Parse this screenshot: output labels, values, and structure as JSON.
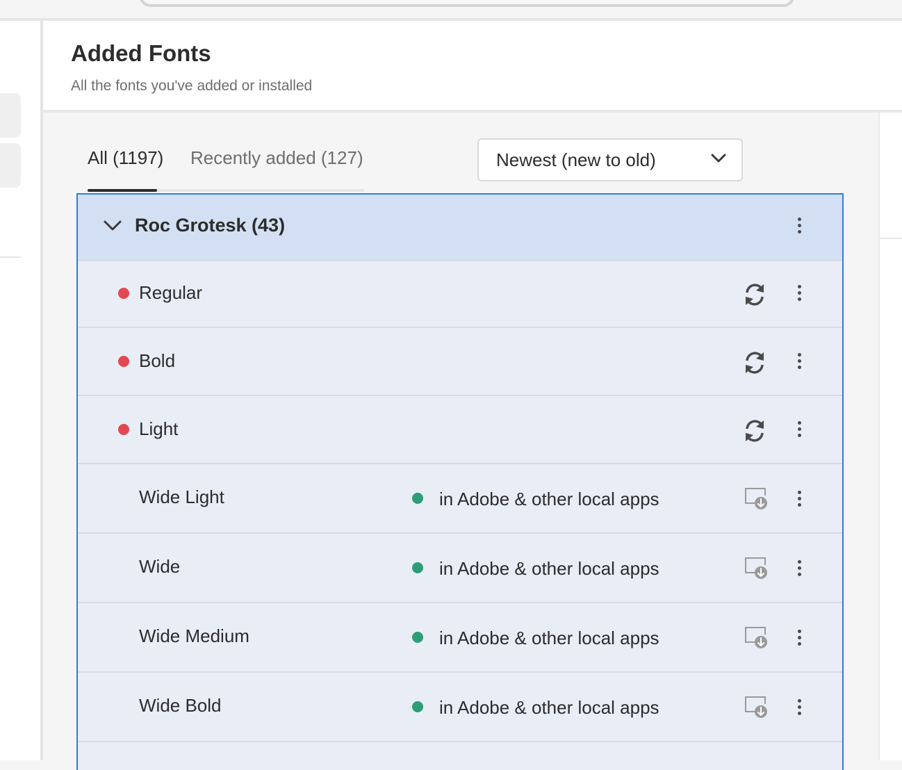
{
  "header": {
    "title": "Added Fonts",
    "subtitle": "All the fonts you've added or installed"
  },
  "tabs": [
    {
      "label": "All (1197)",
      "active": true
    },
    {
      "label": "Recently added (127)",
      "active": false
    }
  ],
  "sort": {
    "selected": "Newest (new to old)",
    "icon": "chevron-down-icon"
  },
  "family": {
    "name": "Roc Grotesk (43)",
    "expanded": true
  },
  "styles": [
    {
      "name": "Regular",
      "status_color": "red",
      "status_text": "",
      "action_icon": "sync-icon"
    },
    {
      "name": "Bold",
      "status_color": "red",
      "status_text": "",
      "action_icon": "sync-icon"
    },
    {
      "name": "Light",
      "status_color": "red",
      "status_text": "",
      "action_icon": "sync-icon"
    },
    {
      "name": "Wide Light",
      "status_color": "green",
      "status_text": "in Adobe & other local apps",
      "action_icon": "install-icon"
    },
    {
      "name": "Wide",
      "status_color": "green",
      "status_text": "in Adobe & other local apps",
      "action_icon": "install-icon"
    },
    {
      "name": "Wide Medium",
      "status_color": "green",
      "status_text": "in Adobe & other local apps",
      "action_icon": "install-icon"
    },
    {
      "name": "Wide Bold",
      "status_color": "green",
      "status_text": "in Adobe & other local apps",
      "action_icon": "install-icon"
    }
  ],
  "colors": {
    "accent_border": "#2f7ed8",
    "family_row_bg": "#d3e0f3",
    "row_bg": "#e8edf6",
    "status_red": "#e34850",
    "status_green": "#2d9d78"
  }
}
